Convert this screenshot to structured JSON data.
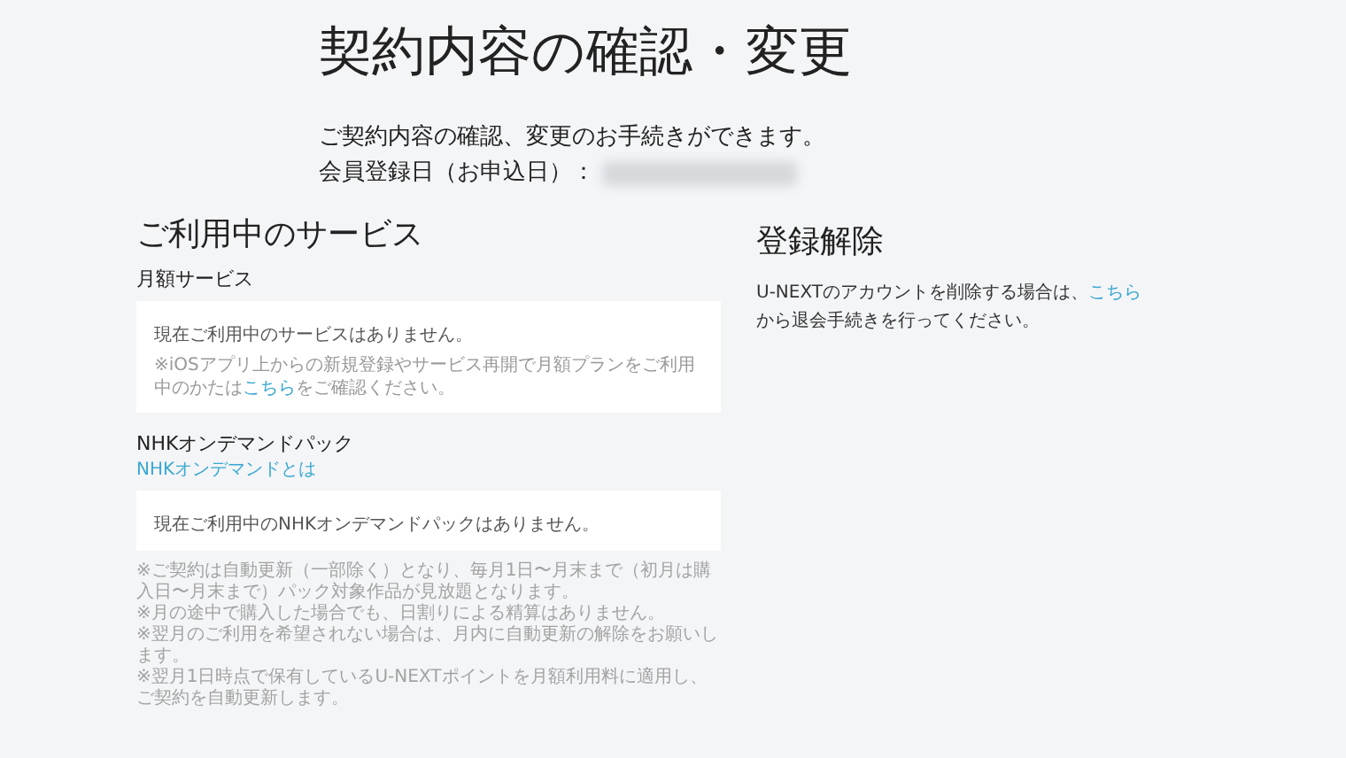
{
  "page_title": "契約内容の確認・変更",
  "intro": "ご契約内容の確認、変更のお手続きができます。",
  "registration": {
    "label": "会員登録日（お申込日）：",
    "value_hidden": true
  },
  "services": {
    "heading": "ご利用中のサービス",
    "sections": [
      {
        "title": "月額サービス",
        "status": "現在ご利用中のサービスはありません。",
        "note": {
          "before": "※iOSアプリ上からの新規登録やサービス再開で月額プランをご利用中のかたは",
          "link": "こちら",
          "after": "をご確認ください。"
        }
      },
      {
        "title": "NHKオンデマンドパック",
        "title_link": "NHKオンデマンドとは",
        "status": "現在ご利用中のNHKオンデマンドパックはありません。"
      }
    ],
    "notes": [
      "※ご契約は自動更新（一部除く）となり、毎月1日〜月末まで（初月は購入日〜月末まで）パック対象作品が見放題となります。",
      "※月の途中で購入した場合でも、日割りによる精算はありません。",
      "※翌月のご利用を希望されない場合は、月内に自動更新の解除をお願いします。",
      "※翌月1日時点で保有しているU-NEXTポイントを月額利用料に適用し、ご契約を自動更新します。"
    ]
  },
  "unregister": {
    "heading": "登録解除",
    "text": {
      "before": "U-NEXTのアカウントを削除する場合は、",
      "link": "こちら",
      "after": "から退会手続きを行ってください。"
    }
  }
}
